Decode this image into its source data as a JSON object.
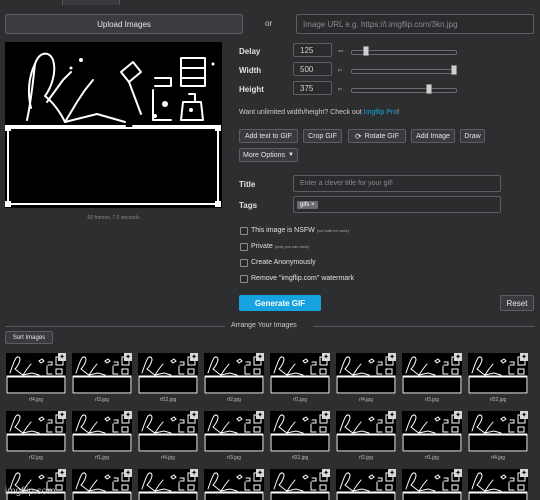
{
  "upload": {
    "button_label": "Upload Images",
    "or_text": "or",
    "url_placeholder": "Image URL e.g. https://i.imgflip.com/3kn.jpg"
  },
  "preview": {
    "info": "60 frames, 7.5 seconds"
  },
  "settings": {
    "delay": {
      "label": "Delay",
      "value": "125",
      "unit": "ms",
      "level": 0.12
    },
    "width": {
      "label": "Width",
      "value": "500",
      "unit": "px",
      "level": 1.0
    },
    "height": {
      "label": "Height",
      "value": "375",
      "unit": "px",
      "level": 0.75
    }
  },
  "promo": {
    "text": "Want unlimited width/height? Check out ",
    "link": "Imgflip Pro",
    "end": "!"
  },
  "tools": {
    "add_text": "Add text to GIF",
    "crop": "Crop GIF",
    "rotate": "Rotate GIF",
    "add_image": "Add Image",
    "draw": "Draw",
    "more_options": "More Options"
  },
  "meta": {
    "title_label": "Title",
    "title_placeholder": "Enter a clever title for your gif!",
    "tags_label": "Tags",
    "tag": "gifs"
  },
  "checkboxes": {
    "nsfw": {
      "label": "This image is NSFW",
      "note": "(not safe for work)"
    },
    "private": {
      "label": "Private",
      "note": "(only you can view)"
    },
    "anonymous": {
      "label": "Create Anonymously"
    },
    "watermark": {
      "label": "Remove \"imgflip.com\" watermark"
    }
  },
  "actions": {
    "generate": "Generate GIF",
    "reset": "Reset"
  },
  "arrange": {
    "heading": "Arrange Your Images",
    "sort": "Sort Images"
  },
  "frames": {
    "row1": [
      "rf4.jpg",
      "rf3.jpg",
      "rf22.jpg",
      "rf2.jpg",
      "rf1.jpg",
      "rf4.jpg",
      "rf3.jpg",
      "rf22.jpg"
    ],
    "row2": [
      "rf2.jpg",
      "rf1.jpg",
      "rf4.jpg",
      "rf3.jpg",
      "rf22.jpg",
      "rf2.jpg",
      "rf1.jpg",
      "rf4.jpg"
    ]
  },
  "watermark_text": "imgflip.com",
  "colors": {
    "accent": "#17a3df",
    "bg": "#2d2e30"
  }
}
